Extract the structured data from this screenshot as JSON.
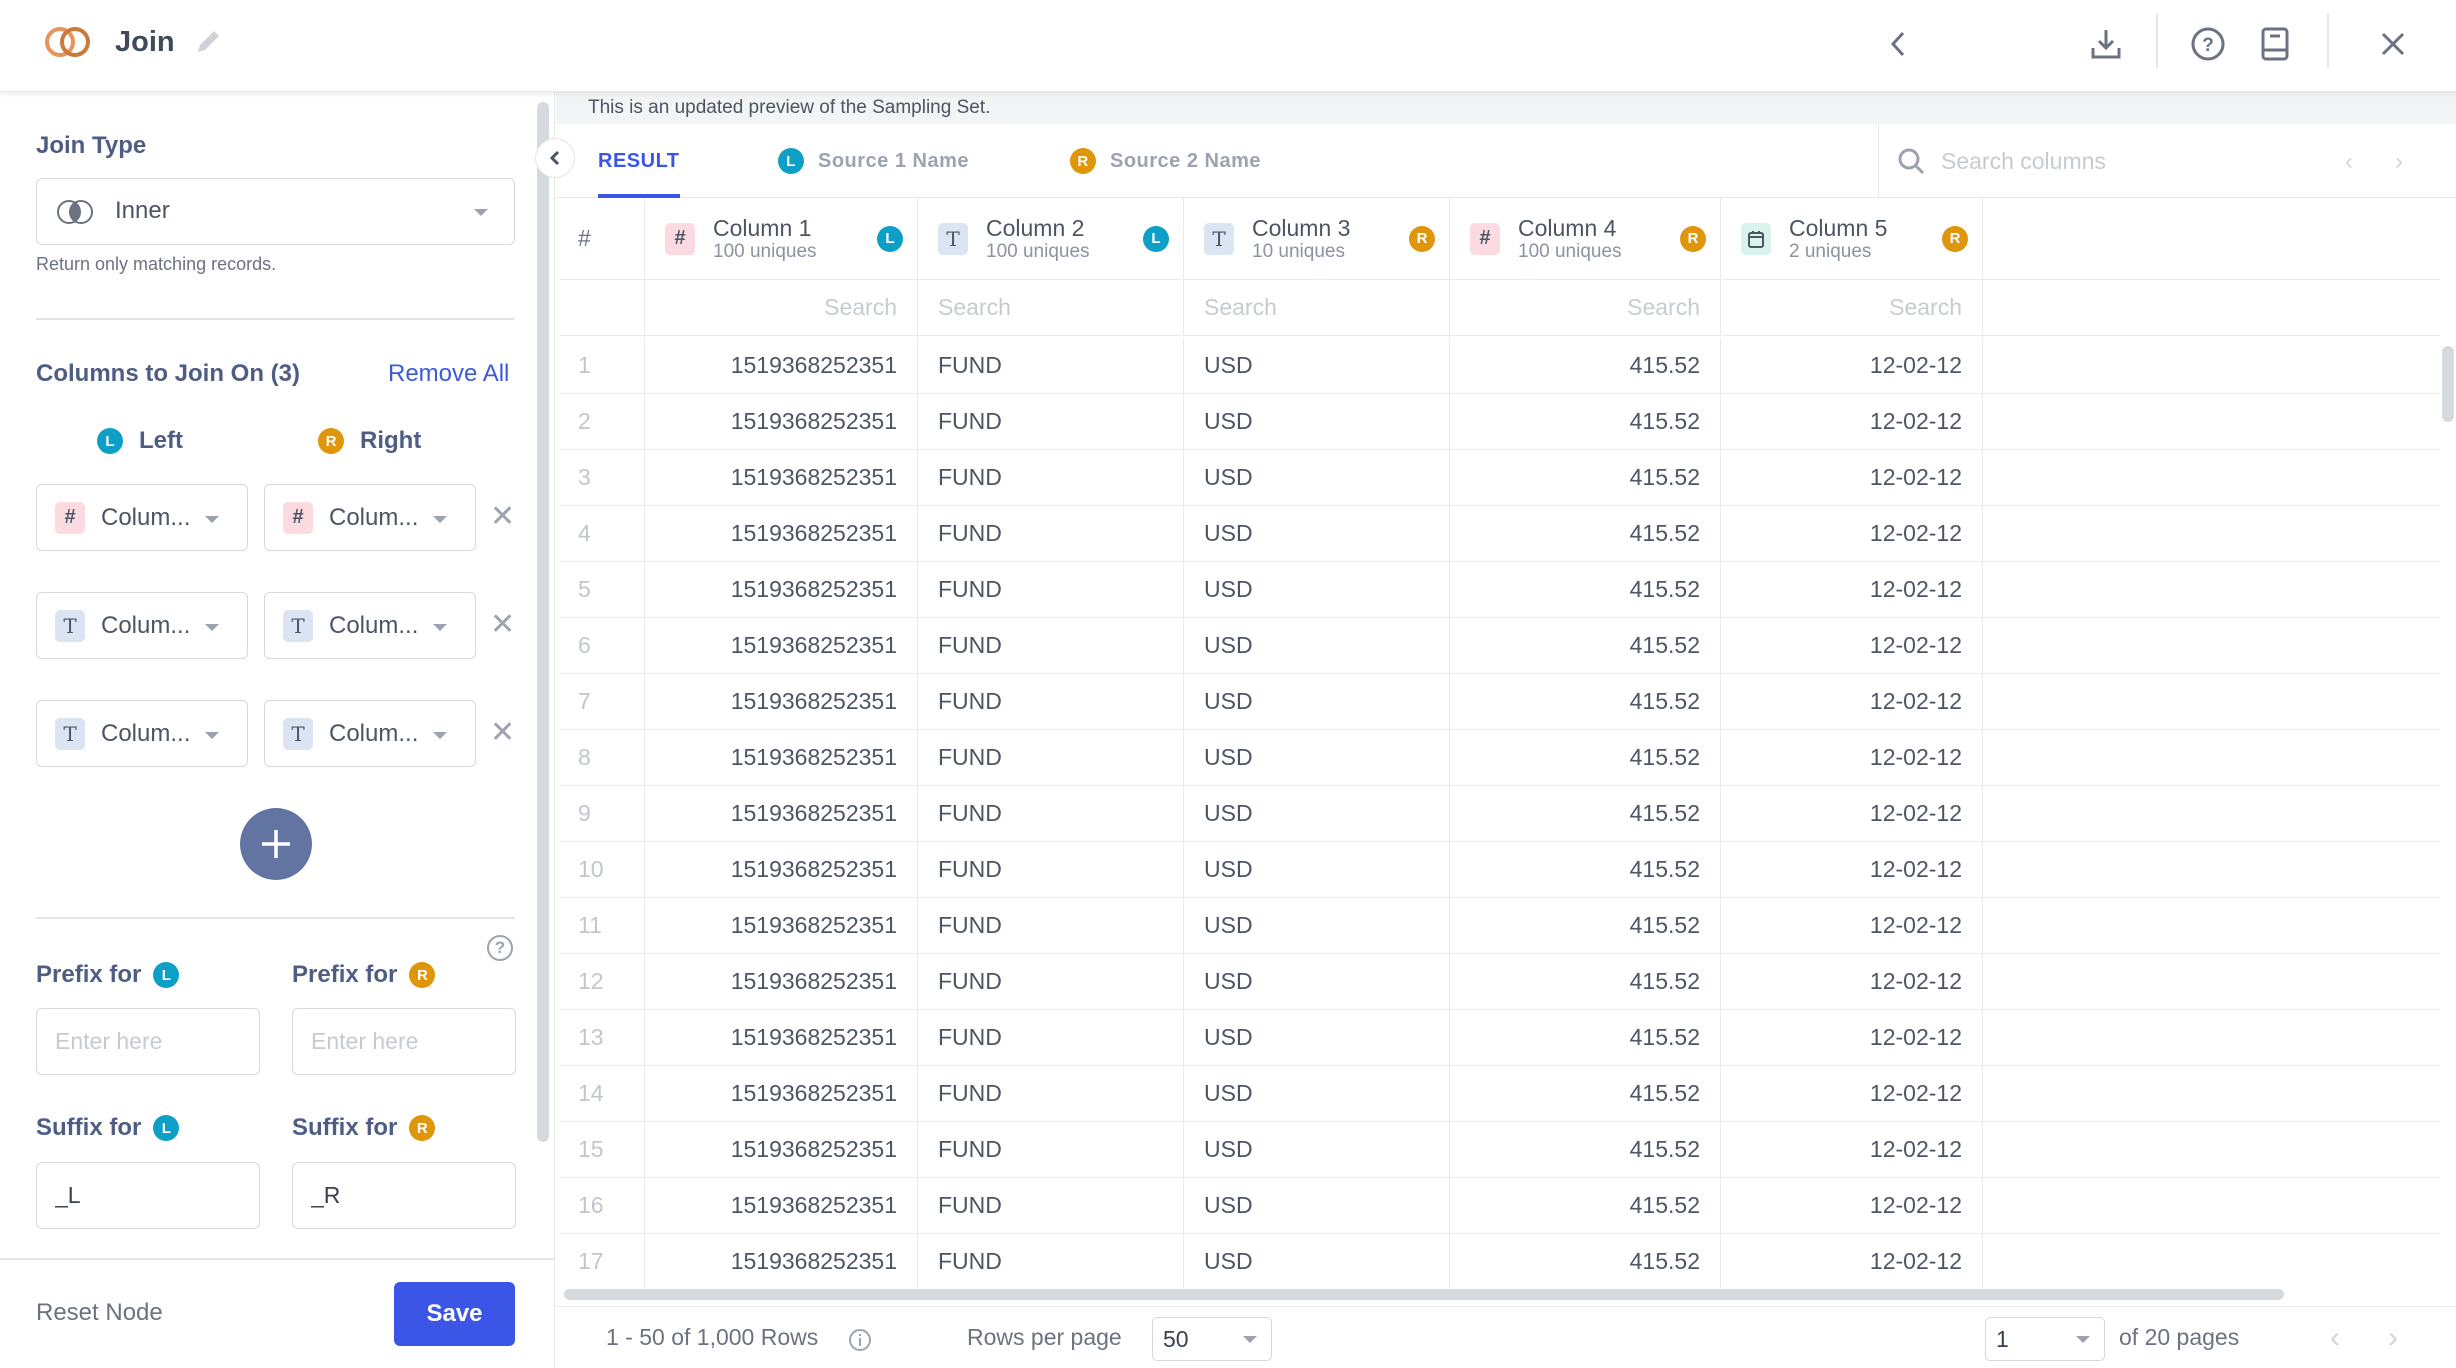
{
  "header": {
    "title": "Join",
    "icons": [
      "join-logo-icon",
      "edit-pencil-icon",
      "chevron-left-icon",
      "download-icon",
      "help-icon",
      "book-icon",
      "close-icon"
    ]
  },
  "left_panel": {
    "join_type_label": "Join Type",
    "join_type_value": "Inner",
    "join_type_help": "Return only matching records.",
    "columns_to_join_label": "Columns to Join On (3)",
    "remove_all_label": "Remove All",
    "left_label": "Left",
    "right_label": "Right",
    "left_badge": "L",
    "right_badge": "R",
    "join_pairs": [
      {
        "left": {
          "type": "#",
          "value": "Colum..."
        },
        "right": {
          "type": "#",
          "value": "Colum..."
        }
      },
      {
        "left": {
          "type": "T",
          "value": "Colum..."
        },
        "right": {
          "type": "T",
          "value": "Colum..."
        }
      },
      {
        "left": {
          "type": "T",
          "value": "Colum..."
        },
        "right": {
          "type": "T",
          "value": "Colum..."
        }
      }
    ],
    "prefix_left_label": "Prefix for",
    "prefix_right_label": "Prefix for",
    "prefix_left_placeholder": "Enter here",
    "prefix_right_placeholder": "Enter here",
    "suffix_left_label": "Suffix for",
    "suffix_right_label": "Suffix for",
    "suffix_left_value": "_L",
    "suffix_right_value": "_R",
    "help_glyph": "?",
    "reset_label": "Reset Node",
    "save_label": "Save"
  },
  "preview": {
    "notice": "This is an updated preview of the Sampling Set.",
    "tabs": [
      {
        "label": "RESULT",
        "badge": ""
      },
      {
        "label": "Source 1 Name",
        "badge": "L"
      },
      {
        "label": "Source 2 Name",
        "badge": "R"
      }
    ],
    "search_placeholder": "Search columns",
    "index_header": "#",
    "columns": [
      {
        "name": "Column 1",
        "uniques": "100 uniques",
        "type": "#",
        "source": "L",
        "align": "right"
      },
      {
        "name": "Column 2",
        "uniques": "100 uniques",
        "type": "T",
        "source": "L",
        "align": "left"
      },
      {
        "name": "Column 3",
        "uniques": "10 uniques",
        "type": "T",
        "source": "R",
        "align": "left"
      },
      {
        "name": "Column 4",
        "uniques": "100 uniques",
        "type": "#",
        "source": "R",
        "align": "right"
      },
      {
        "name": "Column 5",
        "uniques": "2 uniques",
        "type": "date",
        "source": "R",
        "align": "right"
      }
    ],
    "column_search_placeholder": "Search",
    "rows": [
      [
        "1",
        "1519368252351",
        "FUND",
        "USD",
        "415.52",
        "12-02-12"
      ],
      [
        "2",
        "1519368252351",
        "FUND",
        "USD",
        "415.52",
        "12-02-12"
      ],
      [
        "3",
        "1519368252351",
        "FUND",
        "USD",
        "415.52",
        "12-02-12"
      ],
      [
        "4",
        "1519368252351",
        "FUND",
        "USD",
        "415.52",
        "12-02-12"
      ],
      [
        "5",
        "1519368252351",
        "FUND",
        "USD",
        "415.52",
        "12-02-12"
      ],
      [
        "6",
        "1519368252351",
        "FUND",
        "USD",
        "415.52",
        "12-02-12"
      ],
      [
        "7",
        "1519368252351",
        "FUND",
        "USD",
        "415.52",
        "12-02-12"
      ],
      [
        "8",
        "1519368252351",
        "FUND",
        "USD",
        "415.52",
        "12-02-12"
      ],
      [
        "9",
        "1519368252351",
        "FUND",
        "USD",
        "415.52",
        "12-02-12"
      ],
      [
        "10",
        "1519368252351",
        "FUND",
        "USD",
        "415.52",
        "12-02-12"
      ],
      [
        "11",
        "1519368252351",
        "FUND",
        "USD",
        "415.52",
        "12-02-12"
      ],
      [
        "12",
        "1519368252351",
        "FUND",
        "USD",
        "415.52",
        "12-02-12"
      ],
      [
        "13",
        "1519368252351",
        "FUND",
        "USD",
        "415.52",
        "12-02-12"
      ],
      [
        "14",
        "1519368252351",
        "FUND",
        "USD",
        "415.52",
        "12-02-12"
      ],
      [
        "15",
        "1519368252351",
        "FUND",
        "USD",
        "415.52",
        "12-02-12"
      ],
      [
        "16",
        "1519368252351",
        "FUND",
        "USD",
        "415.52",
        "12-02-12"
      ],
      [
        "17",
        "1519368252351",
        "FUND",
        "USD",
        "415.52",
        "12-02-12"
      ]
    ],
    "pagination": {
      "range_text": "1 - 50 of 1,000 Rows",
      "rows_per_page_label": "Rows per page",
      "rows_per_page_value": "50",
      "page_value": "1",
      "page_total_text": "of 20 pages"
    }
  },
  "colors": {
    "accent": "#3b55e6",
    "left_source": "#0e9fc7",
    "right_source": "#e0960a",
    "label": "#4f5d85",
    "add_button": "#6274a2"
  }
}
